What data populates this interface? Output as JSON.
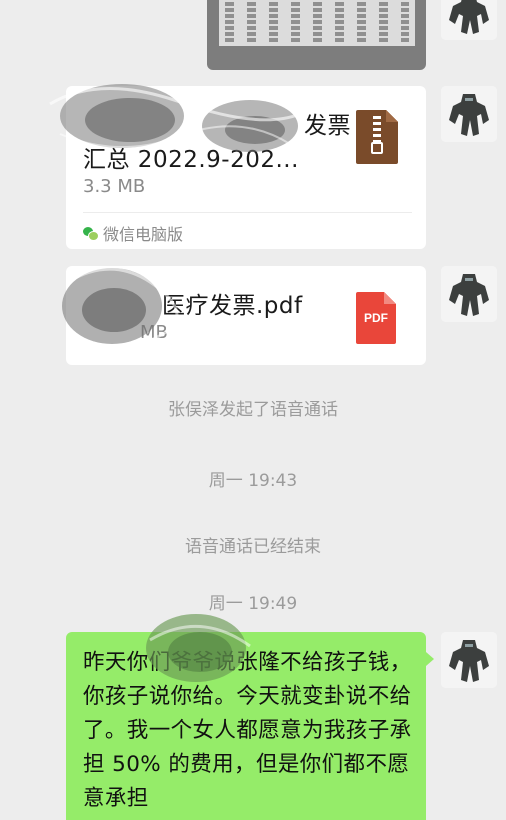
{
  "chat": {
    "messages": [
      {
        "type": "image",
        "description_icon": "spreadsheet-image"
      },
      {
        "type": "file",
        "name_line1": "发票",
        "name_line2": "汇总 2022.9-202...",
        "size": "3.3 MB",
        "source": "微信电脑版",
        "icon": "zip-file-icon",
        "icon_color": "#7a4b2a"
      },
      {
        "type": "file",
        "name": "医疗发票.pdf",
        "size": "MB",
        "icon": "pdf-file-icon",
        "icon_label": "PDF",
        "icon_color": "#e9463a"
      },
      {
        "type": "system",
        "text": "张俣泽发起了语音通话"
      },
      {
        "type": "time",
        "text": "周一 19:43"
      },
      {
        "type": "system",
        "text": "语音通话已经结束"
      },
      {
        "type": "time",
        "text": "周一 19:49"
      },
      {
        "type": "text",
        "bubble_color": "#95ec69",
        "text": "昨天你们爷爷说张隆不给孩子钱，你孩子说你给。今天就变卦说不给了。我一个女人都愿意为我孩子承担 50% 的费用，但是你们都不愿意承担"
      }
    ]
  },
  "colors": {
    "background": "#ededed",
    "bubble_sent": "#95ec69",
    "card": "#ffffff",
    "muted_text": "#9b9b9b"
  }
}
